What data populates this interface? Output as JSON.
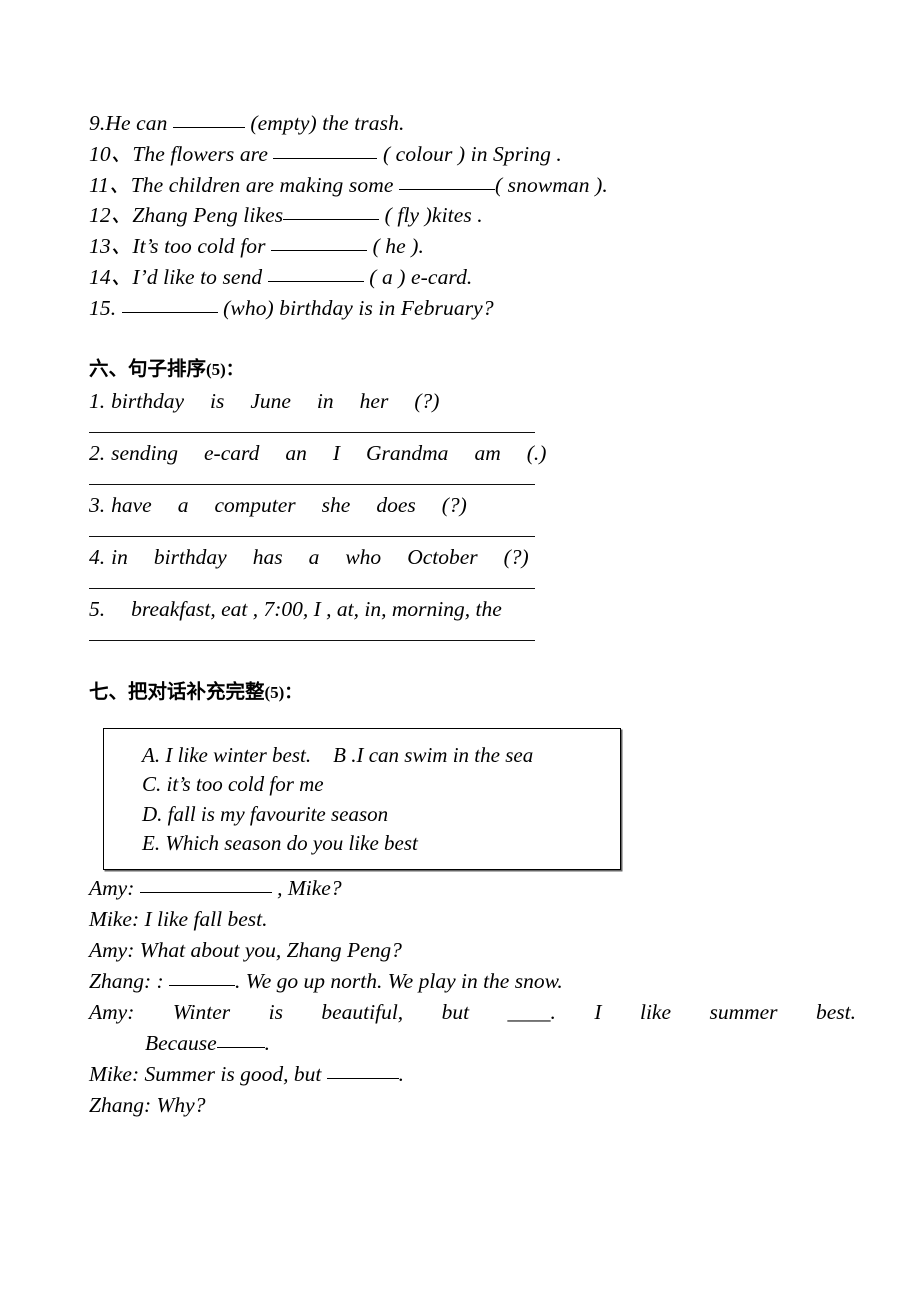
{
  "document": {
    "type": "worksheet",
    "language": "zh-en"
  },
  "fill_in_blanks": {
    "items": [
      {
        "num": "9.",
        "before": "He can ",
        "blank": "b-sm",
        "after": " (empty) the trash."
      },
      {
        "num": "10、",
        "before": "The flowers are ",
        "blank": "b-lg",
        "after": " ( colour ) in Spring ."
      },
      {
        "num": "11、",
        "before": "The children are making some ",
        "blank": "b-md",
        "after": "( snowman )."
      },
      {
        "num": "12、",
        "before": "Zhang Peng likes",
        "blank": "b-md",
        "after": " ( fly )kites ."
      },
      {
        "num": "13、",
        "before": "It’s too cold for ",
        "blank": "b-md",
        "after": " ( he )."
      },
      {
        "num": "14、",
        "before": "I’d like to send ",
        "blank": "b-md",
        "after": " ( a ) e-card."
      },
      {
        "num": "15.",
        "before": " ",
        "blank": "b-md",
        "after": " (who) birthday is in February?"
      }
    ]
  },
  "section_six": {
    "heading_cn": "六、句子排序",
    "heading_score": "(5)：",
    "items": [
      {
        "num": "1.",
        "words": [
          "birthday",
          "is",
          "June",
          "in",
          "her",
          "(?)"
        ]
      },
      {
        "num": "2.",
        "words": [
          "sending",
          "e-card",
          "an",
          "I",
          "Grandma",
          "am",
          "(.)"
        ]
      },
      {
        "num": "3.",
        "words": [
          "have",
          "a",
          "computer",
          "she",
          "does",
          "(?)"
        ]
      },
      {
        "num": "4.",
        "words": [
          "in",
          "birthday",
          "has",
          "a",
          "who",
          "October",
          "(?)"
        ]
      },
      {
        "num": "5.",
        "plain": "breakfast, eat , 7:00, I , at, in, morning, the"
      }
    ]
  },
  "section_seven": {
    "heading_cn": "七、把对话补充完整",
    "heading_score": "(5)：",
    "option_box": {
      "lines": [
        {
          "a": "A. I like winter best.",
          "b": "B .I can swim in the sea"
        },
        {
          "a": "C. it’s too cold for me"
        },
        {
          "a": "D. fall is my favourite season"
        },
        {
          "a": "E. Which season do you like best"
        }
      ]
    },
    "dialogue": [
      {
        "speaker": "Amy:",
        "before": " ",
        "blank": true,
        "after": " , Mike?"
      },
      {
        "speaker": "Mike:",
        "before": " I like fall best.",
        "blank": false,
        "after": ""
      },
      {
        "speaker": "Amy:",
        "before": " What about you, Zhang Peng?",
        "blank": false,
        "after": ""
      },
      {
        "speaker": "Zhang:",
        "before": " : ",
        "blank": true,
        "after": ".   We go up north. We play in the snow."
      },
      {
        "speaker": "Amy:",
        "justified": true,
        "segments": [
          "Winter",
          "is",
          "beautiful,",
          "but",
          "____.",
          "I",
          "like",
          "summer",
          "best."
        ]
      },
      {
        "indent": true,
        "text_before": "Because",
        "blank": true,
        "text_after": "."
      },
      {
        "speaker": "Mike:",
        "before": " Summer is good, but ",
        "blank": true,
        "after": "."
      },
      {
        "speaker": "Zhang:",
        "before": " Why?",
        "blank": false,
        "after": ""
      }
    ]
  }
}
